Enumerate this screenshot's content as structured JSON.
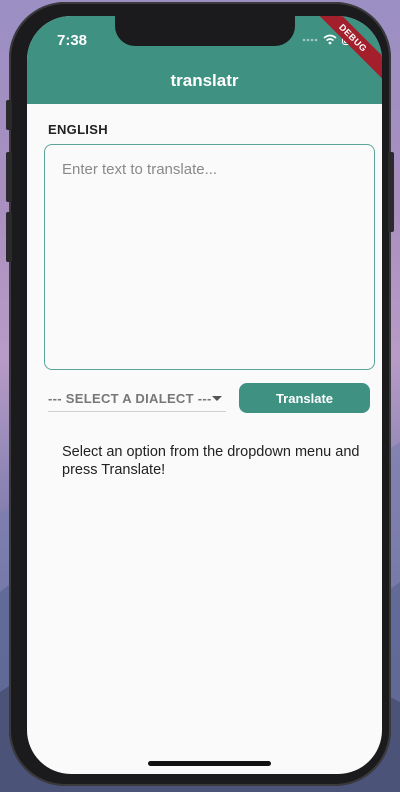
{
  "status_bar": {
    "time": "7:38",
    "debug_banner": "DEBUG"
  },
  "appbar": {
    "title": "translatr"
  },
  "source": {
    "language_label": "ENGLISH",
    "input_value": "",
    "input_placeholder": "Enter text to translate..."
  },
  "controls": {
    "dialect_selected": "--- SELECT A DIALECT ---",
    "translate_label": "Translate"
  },
  "output": {
    "message": "Select an option from the dropdown menu and press Translate!"
  },
  "colors": {
    "accent": "#3f9182",
    "background": "#fafafa",
    "debug": "#a31f2b"
  },
  "icons": [
    "wifi-icon",
    "battery-icon",
    "signal-icon",
    "dropdown-caret-icon"
  ]
}
